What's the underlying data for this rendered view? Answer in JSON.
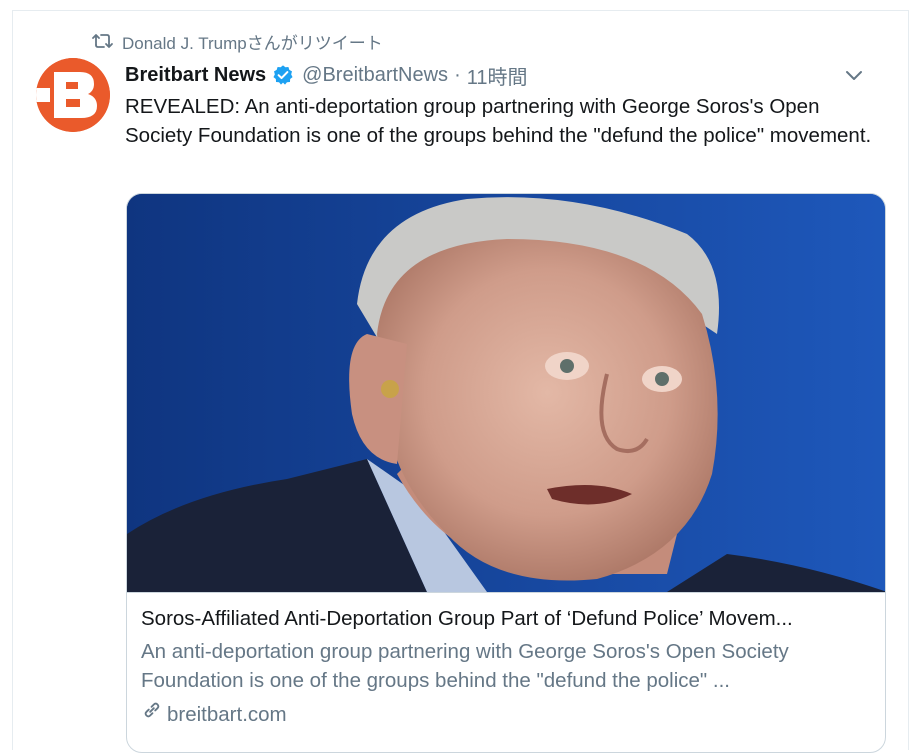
{
  "retweet": {
    "label": "Donald J. Trumpさんがリツイート"
  },
  "tweet": {
    "author_name": "Breitbart News",
    "author_handle": "@BreitbartNews",
    "separator": "·",
    "time": "11時間",
    "avatar_letter": "B",
    "text": "REVEALED: An anti-deportation group partnering with George Soros's Open Society Foundation is one of the groups behind the \"defund the police\" movement."
  },
  "card": {
    "title": "Soros-Affiliated Anti-Deportation Group Part of ‘Defund Police’ Movem...",
    "description": "An anti-deportation group partnering with George Soros's Open Society Foundation is one of the groups behind the \"defund the police\" ...",
    "domain": "breitbart.com"
  },
  "colors": {
    "brand_orange": "#ea5a2b",
    "verified_blue": "#1da1f2",
    "muted_text": "#657786"
  },
  "icons": {
    "retweet": "retweet-icon",
    "verified": "verified-badge-icon",
    "menu": "chevron-down-icon",
    "link": "link-icon"
  }
}
